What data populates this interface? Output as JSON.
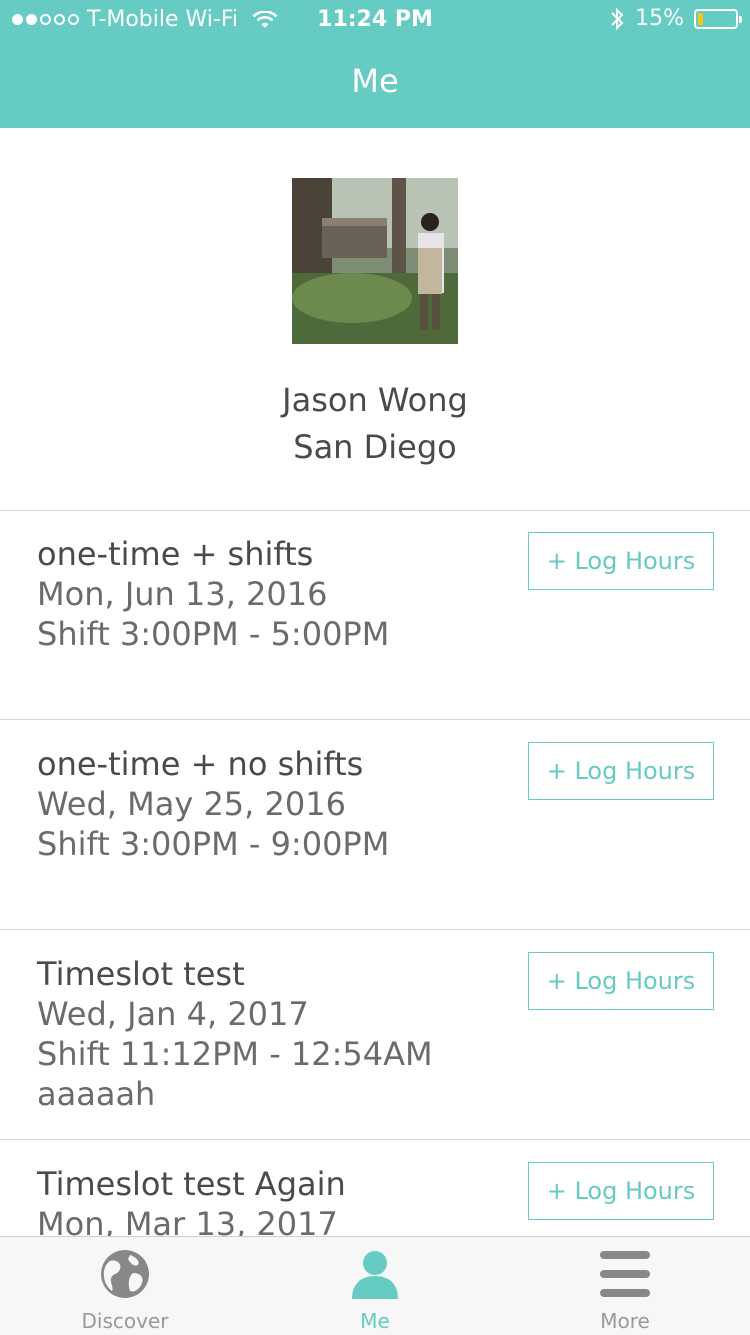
{
  "status_bar": {
    "carrier": "T-Mobile Wi-Fi",
    "time": "11:24 PM",
    "battery": "15%",
    "battery_level": 0.15,
    "signal_bars_filled": 2,
    "signal_bars_total": 5
  },
  "nav": {
    "title": "Me"
  },
  "profile": {
    "name": "Jason Wong",
    "city": "San Diego"
  },
  "events": [
    {
      "title": "one-time + shifts",
      "date": "Mon, Jun 13, 2016",
      "shift": "Shift 3:00PM - 5:00PM",
      "note": "",
      "button": "+ Log Hours"
    },
    {
      "title": "one-time + no shifts",
      "date": "Wed, May 25, 2016",
      "shift": "Shift 3:00PM - 9:00PM",
      "note": "",
      "button": "+ Log Hours"
    },
    {
      "title": "Timeslot test",
      "date": "Wed, Jan 4, 2017",
      "shift": "Shift 11:12PM - 12:54AM",
      "note": "aaaaah",
      "button": "+ Log Hours"
    },
    {
      "title": "Timeslot test Again",
      "date": "Mon, Mar 13, 2017",
      "shift": "",
      "note": "",
      "button": "+ Log Hours"
    }
  ],
  "tabs": [
    {
      "label": "Discover",
      "icon": "globe-icon",
      "active": false
    },
    {
      "label": "Me",
      "icon": "person-icon",
      "active": true
    },
    {
      "label": "More",
      "icon": "menu-icon",
      "active": false
    }
  ],
  "colors": {
    "accent": "#66cbc3",
    "text": "#4a4a4a",
    "inactive_tab": "#999999"
  }
}
